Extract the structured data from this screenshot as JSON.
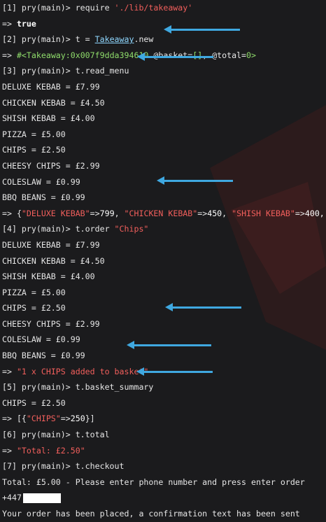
{
  "lines": {
    "l1_prompt": "[1] pry(main)> require ",
    "l1_string": "'./lib/takeaway'",
    "l2_arrow": "=> ",
    "l2_value": "true",
    "l3_prompt": "[2] pry(main)> t = ",
    "l3_class": "Takeaway",
    "l3_method": ".new",
    "l4_arrow": "=> ",
    "l4_object": "#<Takeaway:0x007f9dda394610",
    "l4_rest_a": " @basket=",
    "l4_basket": "[]",
    "l4_rest_b": ", @total=",
    "l4_total": "0",
    "l4_close": ">",
    "l5_prompt": "[3] pry(main)> t.read_menu",
    "menu1": [
      "DELUXE KEBAB = £7.99",
      "CHICKEN KEBAB = £4.50",
      "SHISH KEBAB = £4.00",
      "PIZZA = £5.00",
      "CHIPS = £2.50",
      "CHEESY CHIPS = £2.99",
      "COLESLAW = £0.99",
      "BBQ BEANS = £0.99"
    ],
    "hash_arrow": "=> {",
    "hash_k1": "\"DELUXE KEBAB\"",
    "hash_op1": "=>",
    "hash_v1": "799",
    "hash_sep1": ", ",
    "hash_k2": "\"CHICKEN KEBAB\"",
    "hash_op2": "=>",
    "hash_v2": "450",
    "hash_sep2": ", ",
    "hash_k3": "\"SHISH KEBAB\"",
    "hash_op3": "=>",
    "hash_v3": "400,",
    "l15_prompt": "[4] pry(main)> t.order ",
    "l15_string": "\"Chips\"",
    "menu2": [
      "DELUXE KEBAB = £7.99",
      "CHICKEN KEBAB = £4.50",
      "SHISH KEBAB = £4.00",
      "PIZZA = £5.00",
      "CHIPS = £2.50",
      "CHEESY CHIPS = £2.99",
      "COLESLAW = £0.99",
      "BBQ BEANS = £0.99"
    ],
    "l24_arrow": "=> ",
    "l24_string": "\"1 x CHIPS added to basket\"",
    "l25_prompt": "[5] pry(main)> t.basket_summary",
    "l26_text": "CHIPS = £2.50",
    "l27_open": "=> [{",
    "l27_key": "\"CHIPS\"",
    "l27_op": "=>",
    "l27_val": "250",
    "l27_close": "}]",
    "l28_prompt": "[6] pry(main)> t.total",
    "l29_arrow": "=> ",
    "l29_string": "\"Total: £2.50\"",
    "l30_prompt": "[7] pry(main)> t.checkout",
    "l31_text": "Total: £5.00 - Please enter phone number and press enter order",
    "l32_text": "+447",
    "l33_text": "Your order has been placed, a confirmation text has been sent"
  },
  "colors": {
    "background": "#1b1b1d",
    "text": "#e6e6e6",
    "string": "#f25f5c",
    "object": "#8fdc6b",
    "class_link": "#8fd7ff",
    "arrow_annotation": "#3fa8e0"
  }
}
